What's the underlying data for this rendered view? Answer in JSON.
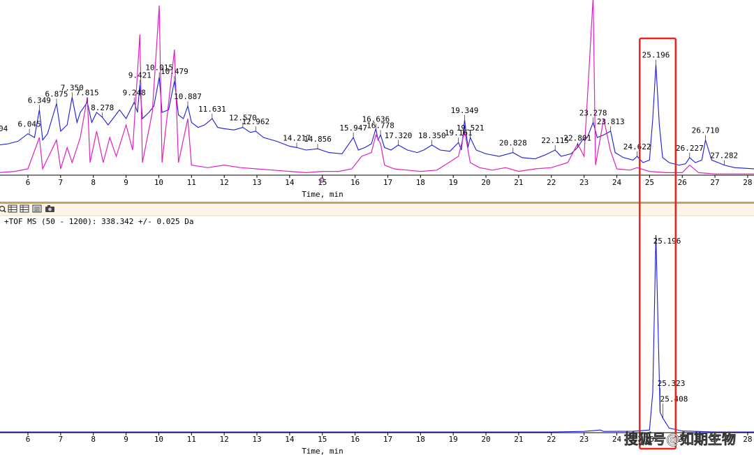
{
  "chart_data": [
    {
      "type": "line",
      "xlabel": "Time, min",
      "xlim": [
        5.1,
        28.2
      ],
      "x_ticks": [
        6,
        7,
        8,
        9,
        10,
        11,
        12,
        13,
        14,
        15,
        16,
        17,
        18,
        19,
        20,
        21,
        22,
        23,
        24,
        25,
        26,
        27,
        28
      ],
      "series": [
        {
          "color": "#1a1adc",
          "points": [
            [
              5.1,
              0.24
            ],
            [
              5.4,
              0.25
            ],
            [
              5.7,
              0.27
            ],
            [
              6.0,
              0.33
            ],
            [
              6.2,
              0.3
            ],
            [
              6.349,
              0.52
            ],
            [
              6.45,
              0.28
            ],
            [
              6.6,
              0.33
            ],
            [
              6.875,
              0.57
            ],
            [
              7.0,
              0.35
            ],
            [
              7.2,
              0.4
            ],
            [
              7.35,
              0.62
            ],
            [
              7.5,
              0.42
            ],
            [
              7.6,
              0.5
            ],
            [
              7.815,
              0.58
            ],
            [
              7.95,
              0.42
            ],
            [
              8.1,
              0.5
            ],
            [
              8.278,
              0.46
            ],
            [
              8.45,
              0.4
            ],
            [
              8.6,
              0.45
            ],
            [
              8.8,
              0.52
            ],
            [
              9.0,
              0.45
            ],
            [
              9.248,
              0.58
            ],
            [
              9.35,
              0.5
            ],
            [
              9.421,
              0.72
            ],
            [
              9.5,
              0.45
            ],
            [
              9.7,
              0.5
            ],
            [
              9.85,
              0.55
            ],
            [
              10.015,
              0.78
            ],
            [
              10.1,
              0.5
            ],
            [
              10.3,
              0.52
            ],
            [
              10.479,
              0.75
            ],
            [
              10.6,
              0.48
            ],
            [
              10.75,
              0.45
            ],
            [
              10.887,
              0.55
            ],
            [
              11.0,
              0.42
            ],
            [
              11.2,
              0.38
            ],
            [
              11.4,
              0.4
            ],
            [
              11.631,
              0.45
            ],
            [
              11.8,
              0.38
            ],
            [
              12.0,
              0.37
            ],
            [
              12.3,
              0.36
            ],
            [
              12.57,
              0.38
            ],
            [
              12.8,
              0.34
            ],
            [
              12.962,
              0.35
            ],
            [
              13.2,
              0.3
            ],
            [
              13.6,
              0.27
            ],
            [
              14.0,
              0.23
            ],
            [
              14.217,
              0.22
            ],
            [
              14.5,
              0.2
            ],
            [
              14.856,
              0.21
            ],
            [
              15.2,
              0.18
            ],
            [
              15.6,
              0.17
            ],
            [
              15.947,
              0.3
            ],
            [
              16.1,
              0.2
            ],
            [
              16.3,
              0.22
            ],
            [
              16.5,
              0.25
            ],
            [
              16.636,
              0.37
            ],
            [
              16.7,
              0.28
            ],
            [
              16.778,
              0.32
            ],
            [
              16.9,
              0.22
            ],
            [
              17.1,
              0.2
            ],
            [
              17.32,
              0.24
            ],
            [
              17.6,
              0.2
            ],
            [
              17.9,
              0.18
            ],
            [
              18.1,
              0.2
            ],
            [
              18.35,
              0.24
            ],
            [
              18.6,
              0.2
            ],
            [
              18.9,
              0.19
            ],
            [
              19.161,
              0.26
            ],
            [
              19.25,
              0.2
            ],
            [
              19.349,
              0.44
            ],
            [
              19.45,
              0.22
            ],
            [
              19.521,
              0.3
            ],
            [
              19.7,
              0.2
            ],
            [
              20.0,
              0.17
            ],
            [
              20.4,
              0.15
            ],
            [
              20.828,
              0.18
            ],
            [
              21.1,
              0.14
            ],
            [
              21.5,
              0.13
            ],
            [
              21.8,
              0.16
            ],
            [
              22.115,
              0.2
            ],
            [
              22.3,
              0.15
            ],
            [
              22.6,
              0.17
            ],
            [
              22.801,
              0.22
            ],
            [
              22.95,
              0.28
            ],
            [
              23.1,
              0.3
            ],
            [
              23.278,
              0.42
            ],
            [
              23.4,
              0.3
            ],
            [
              23.6,
              0.32
            ],
            [
              23.813,
              0.35
            ],
            [
              23.95,
              0.18
            ],
            [
              24.2,
              0.14
            ],
            [
              24.5,
              0.12
            ],
            [
              24.622,
              0.15
            ],
            [
              24.8,
              0.1
            ],
            [
              25.0,
              0.12
            ],
            [
              25.1,
              0.45
            ],
            [
              25.196,
              0.88
            ],
            [
              25.3,
              0.4
            ],
            [
              25.4,
              0.14
            ],
            [
              25.6,
              0.1
            ],
            [
              25.9,
              0.08
            ],
            [
              26.1,
              0.09
            ],
            [
              26.227,
              0.14
            ],
            [
              26.4,
              0.1
            ],
            [
              26.6,
              0.12
            ],
            [
              26.71,
              0.28
            ],
            [
              26.9,
              0.12
            ],
            [
              27.1,
              0.1
            ],
            [
              27.282,
              0.08
            ],
            [
              27.6,
              0.06
            ],
            [
              28.2,
              0.05
            ]
          ]
        },
        {
          "color": "#e020c0",
          "points": [
            [
              5.1,
              0.02
            ],
            [
              5.6,
              0.03
            ],
            [
              6.0,
              0.05
            ],
            [
              6.349,
              0.3
            ],
            [
              6.45,
              0.05
            ],
            [
              6.875,
              0.28
            ],
            [
              7.0,
              0.05
            ],
            [
              7.2,
              0.22
            ],
            [
              7.35,
              0.1
            ],
            [
              7.6,
              0.3
            ],
            [
              7.815,
              0.62
            ],
            [
              7.9,
              0.1
            ],
            [
              8.1,
              0.35
            ],
            [
              8.3,
              0.1
            ],
            [
              8.5,
              0.3
            ],
            [
              8.7,
              0.15
            ],
            [
              9.0,
              0.4
            ],
            [
              9.2,
              0.2
            ],
            [
              9.421,
              1.12
            ],
            [
              9.5,
              0.1
            ],
            [
              9.8,
              0.5
            ],
            [
              10.015,
              1.35
            ],
            [
              10.1,
              0.1
            ],
            [
              10.479,
              1.0
            ],
            [
              10.6,
              0.1
            ],
            [
              10.887,
              0.45
            ],
            [
              11.0,
              0.08
            ],
            [
              11.5,
              0.06
            ],
            [
              12.0,
              0.08
            ],
            [
              12.5,
              0.06
            ],
            [
              13.0,
              0.05
            ],
            [
              13.5,
              0.04
            ],
            [
              14.0,
              0.03
            ],
            [
              14.5,
              0.02
            ],
            [
              15.0,
              0.03
            ],
            [
              15.5,
              0.03
            ],
            [
              15.9,
              0.05
            ],
            [
              16.2,
              0.15
            ],
            [
              16.5,
              0.18
            ],
            [
              16.636,
              0.32
            ],
            [
              16.778,
              0.25
            ],
            [
              16.9,
              0.08
            ],
            [
              17.2,
              0.05
            ],
            [
              17.6,
              0.04
            ],
            [
              18.0,
              0.03
            ],
            [
              18.5,
              0.04
            ],
            [
              19.161,
              0.15
            ],
            [
              19.349,
              0.35
            ],
            [
              19.521,
              0.1
            ],
            [
              19.8,
              0.06
            ],
            [
              20.2,
              0.04
            ],
            [
              20.6,
              0.06
            ],
            [
              21.0,
              0.03
            ],
            [
              21.5,
              0.05
            ],
            [
              22.0,
              0.06
            ],
            [
              22.5,
              0.1
            ],
            [
              22.801,
              0.25
            ],
            [
              23.0,
              0.15
            ],
            [
              23.278,
              1.42
            ],
            [
              23.35,
              0.08
            ],
            [
              23.6,
              0.45
            ],
            [
              23.8,
              0.2
            ],
            [
              24.0,
              0.05
            ],
            [
              24.4,
              0.04
            ],
            [
              24.622,
              0.06
            ],
            [
              25.0,
              0.03
            ],
            [
              25.5,
              0.02
            ],
            [
              26.0,
              0.02
            ],
            [
              26.227,
              0.08
            ],
            [
              26.5,
              0.02
            ],
            [
              27.0,
              0.01
            ],
            [
              28.2,
              0.01
            ]
          ]
        }
      ],
      "annotations": [
        "6.045",
        "6.349",
        "6.875",
        "7.350",
        "7.815",
        "8.278",
        "9.248",
        "9.421",
        "10.015",
        "10.479",
        "10.887",
        "11.631",
        "12.570",
        "12.962",
        "14.217",
        "14.856",
        "15.947",
        "16.636",
        "16.778",
        "17.320",
        "18.350",
        "19.161",
        "19.349",
        "19.521",
        "20.828",
        "22.115",
        "22.801",
        "23.278",
        "23.813",
        "24.622",
        "25.196",
        "26.227",
        "26.710",
        "27.282"
      ],
      "cut_label": "04",
      "highlight_box_x": [
        24.7,
        25.8
      ]
    },
    {
      "type": "line",
      "title": "+TOF MS (50 - 1200): 338.342 +/- 0.025 Da",
      "xlabel": "Time, min",
      "xlim": [
        5.1,
        28.2
      ],
      "x_ticks": [
        6,
        7,
        8,
        9,
        10,
        11,
        12,
        13,
        14,
        15,
        16,
        17,
        18,
        19,
        20,
        21,
        22,
        23,
        24,
        25,
        26,
        27,
        28
      ],
      "series": [
        {
          "color": "#1a1adc",
          "points": [
            [
              5.1,
              0.0
            ],
            [
              22.0,
              0.0
            ],
            [
              23.0,
              0.003
            ],
            [
              23.5,
              0.01
            ],
            [
              23.6,
              0.003
            ],
            [
              24.5,
              0.004
            ],
            [
              25.0,
              0.01
            ],
            [
              25.1,
              0.2
            ],
            [
              25.196,
              1.0
            ],
            [
              25.28,
              0.4
            ],
            [
              25.323,
              0.1
            ],
            [
              25.408,
              0.07
            ],
            [
              25.6,
              0.02
            ],
            [
              26.0,
              0.005
            ],
            [
              27.0,
              0.0
            ],
            [
              28.2,
              0.0
            ]
          ]
        }
      ],
      "annotations": [
        "25.196",
        "25.323",
        "25.408"
      ],
      "highlight_box_x": [
        24.7,
        25.8
      ]
    }
  ],
  "toolbar": {
    "icons": [
      "zoom-icon",
      "table-icon",
      "table-icon",
      "list-icon",
      "camera-icon"
    ]
  },
  "cursor_marker": "⚙",
  "watermark": "搜狐号@如期生物",
  "colors": {
    "tic": "#1a1adc",
    "bpc": "#e020c0",
    "highlight": "#e8241c",
    "divider_band": "#fdf4e8",
    "divider_line": "#c8a060"
  }
}
